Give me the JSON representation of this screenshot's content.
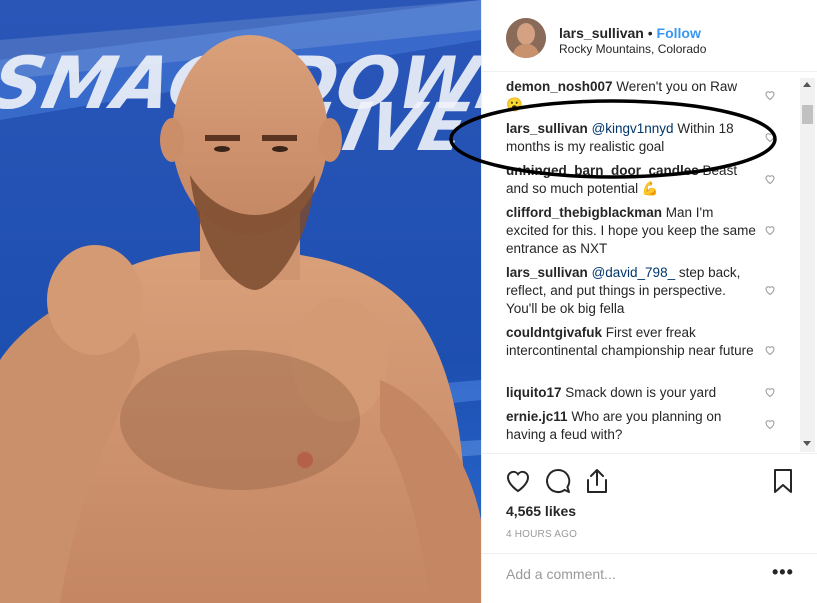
{
  "header": {
    "username": "lars_sullivan",
    "separator": "•",
    "follow_label": "Follow",
    "location": "Rocky Mountains, Colorado"
  },
  "photo": {
    "logo_line1": "SMACKDOWN",
    "logo_line2": "LIVE"
  },
  "comments": [
    {
      "user": "demon_nosh007",
      "mention": "",
      "text": " Weren't you on Raw",
      "emoji": "😮"
    },
    {
      "user": "lars_sullivan",
      "mention": " @kingv1nnyd",
      "text": " Within 18 months is my realistic goal",
      "emoji": ""
    },
    {
      "user": "unhinged_barn_door_candles",
      "mention": "",
      "text": " Beast and so much potential",
      "emoji": "💪"
    },
    {
      "user": "clifford_thebigblackman",
      "mention": "",
      "text": " Man I'm excited for this. I hope you keep the same entrance as NXT",
      "emoji": ""
    },
    {
      "user": "lars_sullivan",
      "mention": " @david_798_",
      "text": " step back, reflect, and put things in perspective. You'll be ok big fella",
      "emoji": ""
    },
    {
      "user": "couldntgivafuk",
      "mention": "",
      "text": " First ever freak intercontinental championship near future",
      "emoji": ""
    },
    {
      "user": "liquito17",
      "mention": "",
      "text": " Smack down is your yard",
      "emoji": ""
    },
    {
      "user": "ernie.jc11",
      "mention": "",
      "text": " Who are you planning on having a feud with?",
      "emoji": ""
    }
  ],
  "actions": {
    "likes": "4,565 likes",
    "time": "4 HOURS AGO",
    "add_comment_placeholder": "Add a comment...",
    "more": "•••"
  },
  "icons": {
    "heart": "heart-icon",
    "comment": "comment-icon",
    "share": "share-icon",
    "bookmark": "bookmark-icon"
  },
  "colors": {
    "link": "#3897f0",
    "mention": "#003569",
    "muted": "#999999",
    "annotation": "#000000"
  }
}
